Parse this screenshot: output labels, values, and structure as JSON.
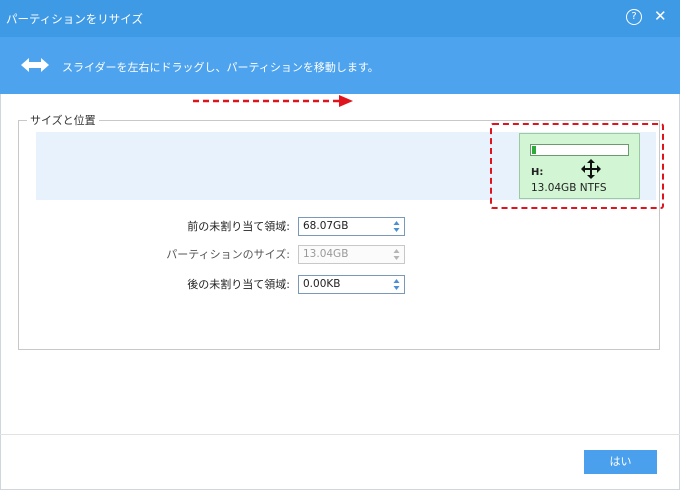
{
  "window": {
    "title": "パーティションをリサイズ",
    "help_label": "?",
    "close_label": "✕"
  },
  "banner": {
    "instruction": "スライダーを左右にドラッグし、パーティションを移動します。"
  },
  "group": {
    "label": "サイズと位置"
  },
  "partition": {
    "drive": "H:",
    "size_fs": "13.04GB NTFS",
    "used_fraction": 0.04
  },
  "fields": [
    {
      "label": "前の未割り当て領域:",
      "value": "68.07GB",
      "enabled": true
    },
    {
      "label": "パーティションのサイズ:",
      "value": "13.04GB",
      "enabled": false
    },
    {
      "label": "後の未割り当て領域:",
      "value": "0.00KB",
      "enabled": true
    }
  ],
  "footer": {
    "ok_label": "はい"
  },
  "colors": {
    "titlebar": "#3f9ae6",
    "banner": "#4da3ee",
    "track": "#e8f2fd",
    "partition": "#d2f6d4",
    "annotation": "#e0141c"
  }
}
